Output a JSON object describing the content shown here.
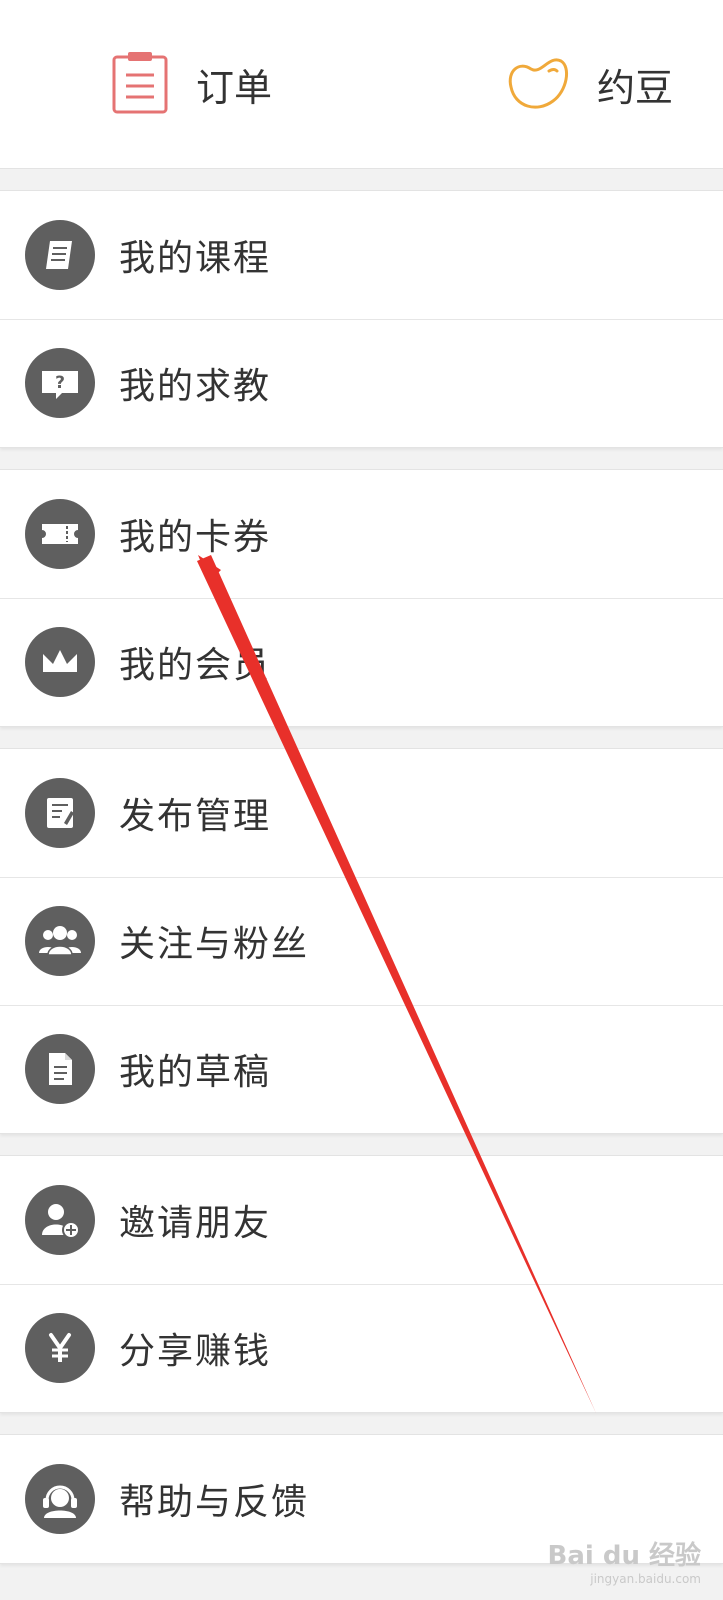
{
  "top": {
    "orders_label": "订单",
    "beans_label": "约豆"
  },
  "menu": {
    "my_courses": "我的课程",
    "my_questions": "我的求教",
    "my_coupons": "我的卡券",
    "my_membership": "我的会员",
    "publish_management": "发布管理",
    "follow_fans": "关注与粉丝",
    "my_drafts": "我的草稿",
    "invite_friends": "邀请朋友",
    "share_earn": "分享赚钱",
    "help_feedback": "帮助与反馈"
  },
  "icons": {
    "orders": "clipboard-list-icon",
    "beans": "bean-icon",
    "my_courses": "book-icon",
    "my_questions": "question-bubble-icon",
    "my_coupons": "ticket-icon",
    "my_membership": "crown-icon",
    "publish_management": "document-edit-icon",
    "follow_fans": "users-group-icon",
    "my_drafts": "file-icon",
    "invite_friends": "add-user-icon",
    "share_earn": "yen-icon",
    "help_feedback": "headset-icon"
  },
  "colors": {
    "orders_icon": "#e57373",
    "beans_icon": "#f0a93a",
    "icon_circle": "#5f5f5f",
    "annotation_arrow": "#e8302a"
  },
  "watermark": {
    "brand": "Bai du 经验",
    "domain": "jingyan.baidu.com"
  }
}
